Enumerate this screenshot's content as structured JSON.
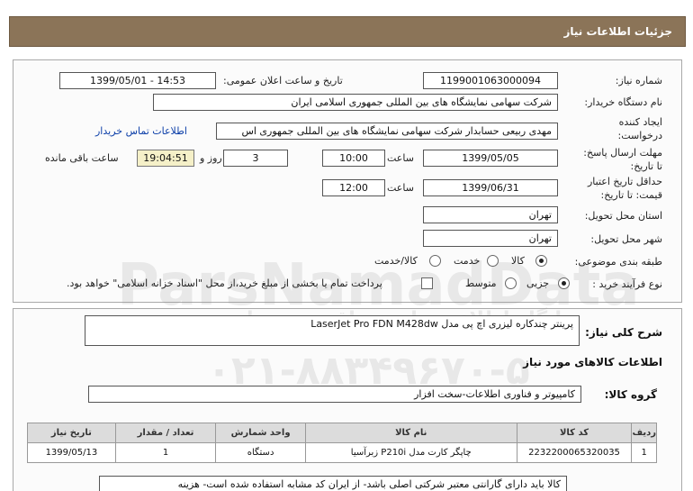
{
  "header": {
    "title": "جزئیات اطلاعات نیاز"
  },
  "need_number": {
    "label": "شماره نیاز:",
    "value": "1199001063000094"
  },
  "announce_datetime": {
    "label": "تاریخ و ساعت اعلان عمومی:",
    "value": "1399/05/01 - 14:53"
  },
  "buyer_org": {
    "label": "نام دستگاه خریدار:",
    "value": "شرکت سهامی نمایشگاه های بین المللی جمهوری اسلامی ایران"
  },
  "requester": {
    "label_line1": "ایجاد کننده",
    "label_line2": "درخواست:",
    "value": "مهدی  ربیعی حسابدار شرکت سهامی نمایشگاه های بین المللی جمهوری اس",
    "contact_link": "اطلاعات تماس خریدار"
  },
  "send_deadline": {
    "label_line1": "مهلت ارسال پاسخ:",
    "label_line2": "تا تاریخ:",
    "date": "1399/05/05",
    "time_label": "ساعت",
    "time": "10:00",
    "days": "3",
    "days_label": "روز و",
    "remaining": "19:04:51",
    "remaining_label": "ساعت باقی مانده"
  },
  "price_validity": {
    "label_line1": "حداقل تاریخ اعتبار",
    "label_line2": "قیمت: تا تاریخ:",
    "date": "1399/06/31",
    "time_label": "ساعت",
    "time": "12:00"
  },
  "delivery_province": {
    "label": "استان محل تحویل:",
    "value": "تهران"
  },
  "delivery_city": {
    "label": "شهر محل تحویل:",
    "value": "تهران"
  },
  "category": {
    "label": "طبقه بندی موضوعی:",
    "options": [
      "کالا",
      "خدمت",
      "کالا/خدمت"
    ],
    "selected": 0
  },
  "purchase_type": {
    "label": "نوع فرآیند خرید :",
    "options": [
      "جزیی",
      "متوسط"
    ],
    "selected": 0,
    "checkbox_text": "پرداخت تمام یا بخشی از مبلغ خرید،از محل \"اسناد خزانه اسلامی\" خواهد بود."
  },
  "summary": {
    "label": "شرح کلی نیاز:",
    "value": "پرینتر چندکاره لیزری اچ پی مدل LaserJet Pro FDN M428dw"
  },
  "goods_info": {
    "label": "اطلاعات کالاهای مورد نیاز"
  },
  "goods_group": {
    "label": "گروه کالا:",
    "value": "کامپیوتر و فناوری اطلاعات-سخت افزار"
  },
  "table": {
    "headers": [
      "ردیف",
      "کد کالا",
      "نام کالا",
      "واحد شمارش",
      "تعداد / مقدار",
      "تاریخ نیاز"
    ],
    "rows": [
      [
        "1",
        "2232200065320035",
        "چاپگر کارت مدل P210i زبرآسیا",
        "دستگاه",
        "1",
        "1399/05/13"
      ]
    ]
  },
  "note": {
    "value": "کالا باید دارای گارانتی معتبر شرکتی اصلی باشد- از ایران کد مشابه استفاده شده است- هزینه"
  },
  "watermark": {
    "line1": "ParsNamadData",
    "line2": "پایگاه اطلاع رسانی مناقصه و مزایده",
    "line3": "۰۲۱-۸۸۳۴۹۶۷۰-۵"
  }
}
